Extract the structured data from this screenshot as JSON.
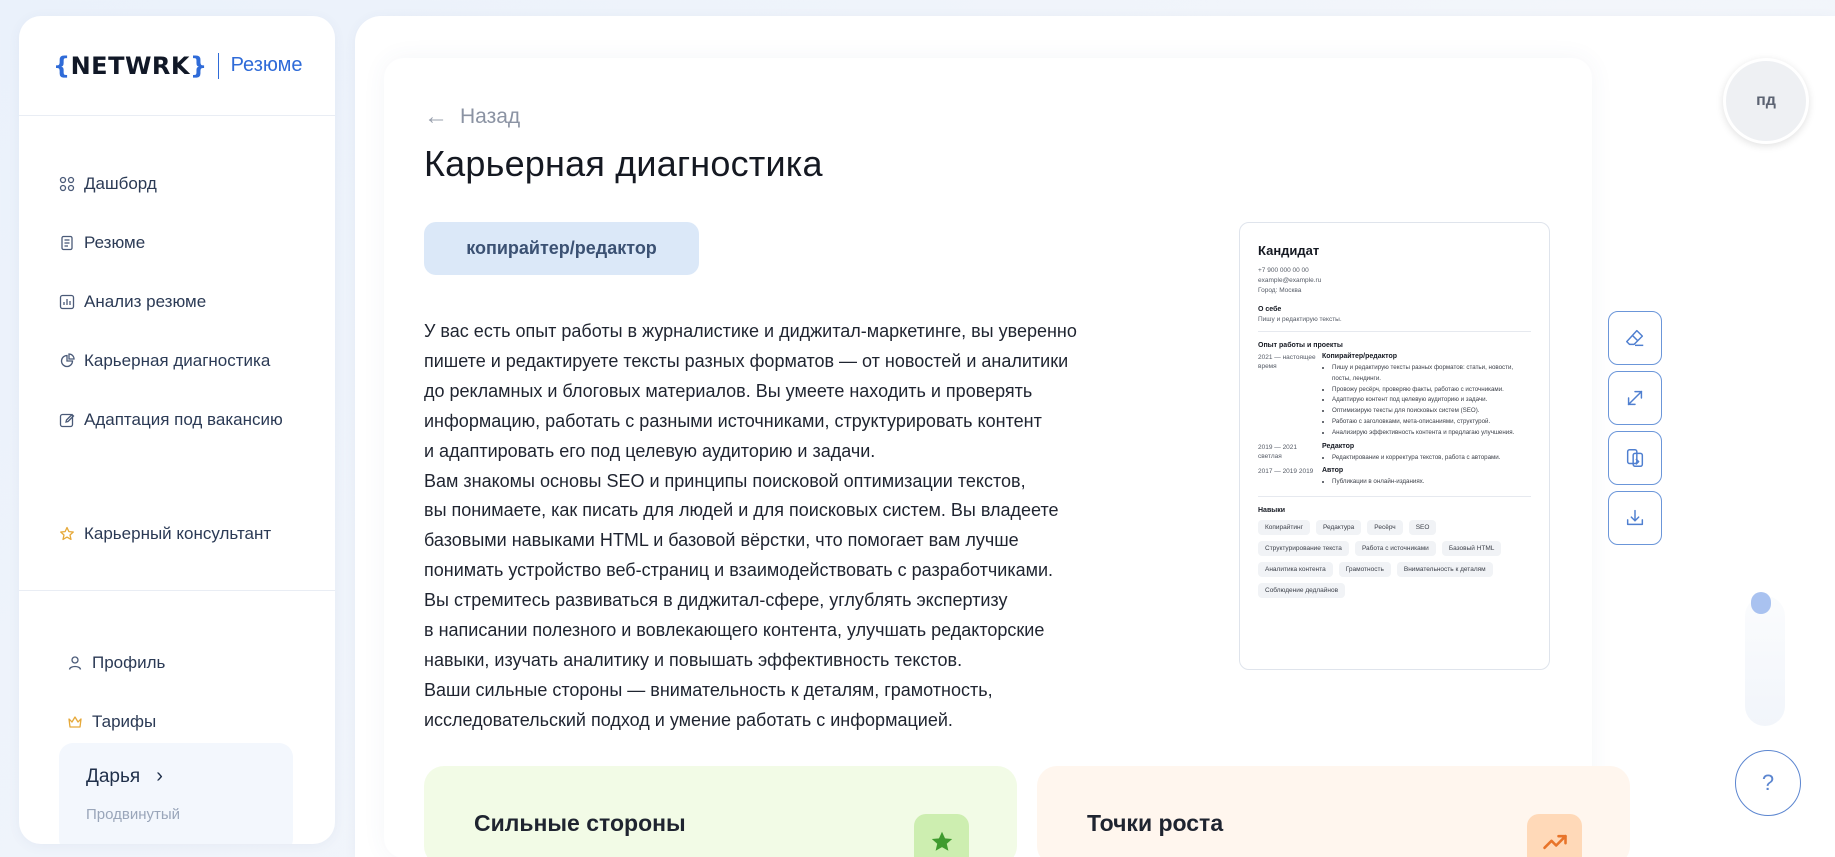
{
  "brand": {
    "logo_open": "{",
    "logo_text": "NETWRK",
    "logo_close": "}",
    "subtitle": "Резюме"
  },
  "sidebar": {
    "items": [
      {
        "label": "Дашборд",
        "icon": "grid-icon"
      },
      {
        "label": "Резюме",
        "icon": "document-icon"
      },
      {
        "label": "Анализ резюме",
        "icon": "chart-icon"
      },
      {
        "label": "Карьерная диагностика",
        "icon": "pie-icon"
      },
      {
        "label": "Адаптация под вакансию",
        "icon": "edit-icon"
      }
    ],
    "consultant": {
      "label": "Карьерный консультант",
      "icon": "star-icon"
    },
    "bottom": [
      {
        "label": "Профиль",
        "icon": "user-icon"
      },
      {
        "label": "Тарифы",
        "icon": "crown-icon"
      }
    ],
    "user": {
      "name": "Дарья",
      "plan": "Продвинутый"
    }
  },
  "page": {
    "back_label": "Назад",
    "title": "Карьерная диагностика",
    "role": "копирайтер/редактор",
    "description": [
      "У вас есть опыт работы в журналистике и диджитал-маркетинге, вы уверенно",
      "пишете и редактируете тексты разных форматов — от новостей и аналитики",
      "до рекламных и блоговых материалов. Вы умеете находить и проверять",
      "информацию, работать с разными источниками, структурировать контент",
      "и адаптировать его под целевую аудиторию и задачи.",
      "Вам знакомы основы SEO и принципы поисковой оптимизации текстов,",
      "вы понимаете, как писать для людей и для поисковых систем. Вы владеете",
      "базовыми навыками HTML и базовой вёрстки, что помогает вам лучше",
      "понимать устройство веб-страниц и взаимодействовать с разработчиками.",
      "Вы стремитесь развиваться в диджитал-сфере, углублять экспертизу",
      "в написании полезного и вовлекающего контента, улучшать редакторские",
      "навыки, изучать аналитику и повышать эффективность текстов.",
      "Ваши сильные стороны — внимательность к деталям, грамотность,",
      "исследовательский подход и умение работать с информацией."
    ],
    "cards": {
      "strengths_title": "Сильные стороны",
      "growth_title": "Точки роста"
    }
  },
  "resume_preview": {
    "name": "Кандидат",
    "phone": "+7 900 000 00 00",
    "email": "example@example.ru",
    "city": "Город: Москва",
    "about_title": "О себе",
    "about_text": "Пишу и редактирую тексты.",
    "experience_title": "Опыт работы и проекты",
    "jobs": [
      {
        "period": "2021 — настоящее время",
        "position": "Копирайтер/редактор",
        "bullets": [
          "Пишу и редактирую тексты разных форматов: статьи, новости, посты, лендинги.",
          "Провожу ресёрч, проверяю факты, работаю с источниками.",
          "Адаптирую контент под целевую аудиторию и задачи.",
          "Оптимизирую тексты для поисковых систем (SEO).",
          "Работаю с заголовками, мета-описаниями, структурой.",
          "Анализирую эффективность контента и предлагаю улучшения."
        ]
      },
      {
        "period": "2019 — 2021 светлая",
        "position": "Редактор",
        "bullets": [
          "Редактирование и корректура текстов, работа с авторами."
        ]
      },
      {
        "period": "2017 — 2019 2019",
        "position": "Автор",
        "bullets": [
          "Публикации в онлайн-изданиях."
        ]
      }
    ],
    "skills_title": "Навыки",
    "skills": [
      "Копирайтинг",
      "Редактура",
      "Ресёрч",
      "SEO",
      "Структурирование текста",
      "Работа с источниками",
      "Базовый HTML",
      "Аналитика контента",
      "Грамотность",
      "Внимательность к деталям",
      "Соблюдение дедлайнов"
    ]
  },
  "header": {
    "avatar_initials": "пд"
  },
  "help": {
    "label": "?"
  },
  "colors": {
    "accent": "#2f6bd8",
    "strengths_bg": "#f2fbe6",
    "growth_bg": "#fff6ee"
  }
}
